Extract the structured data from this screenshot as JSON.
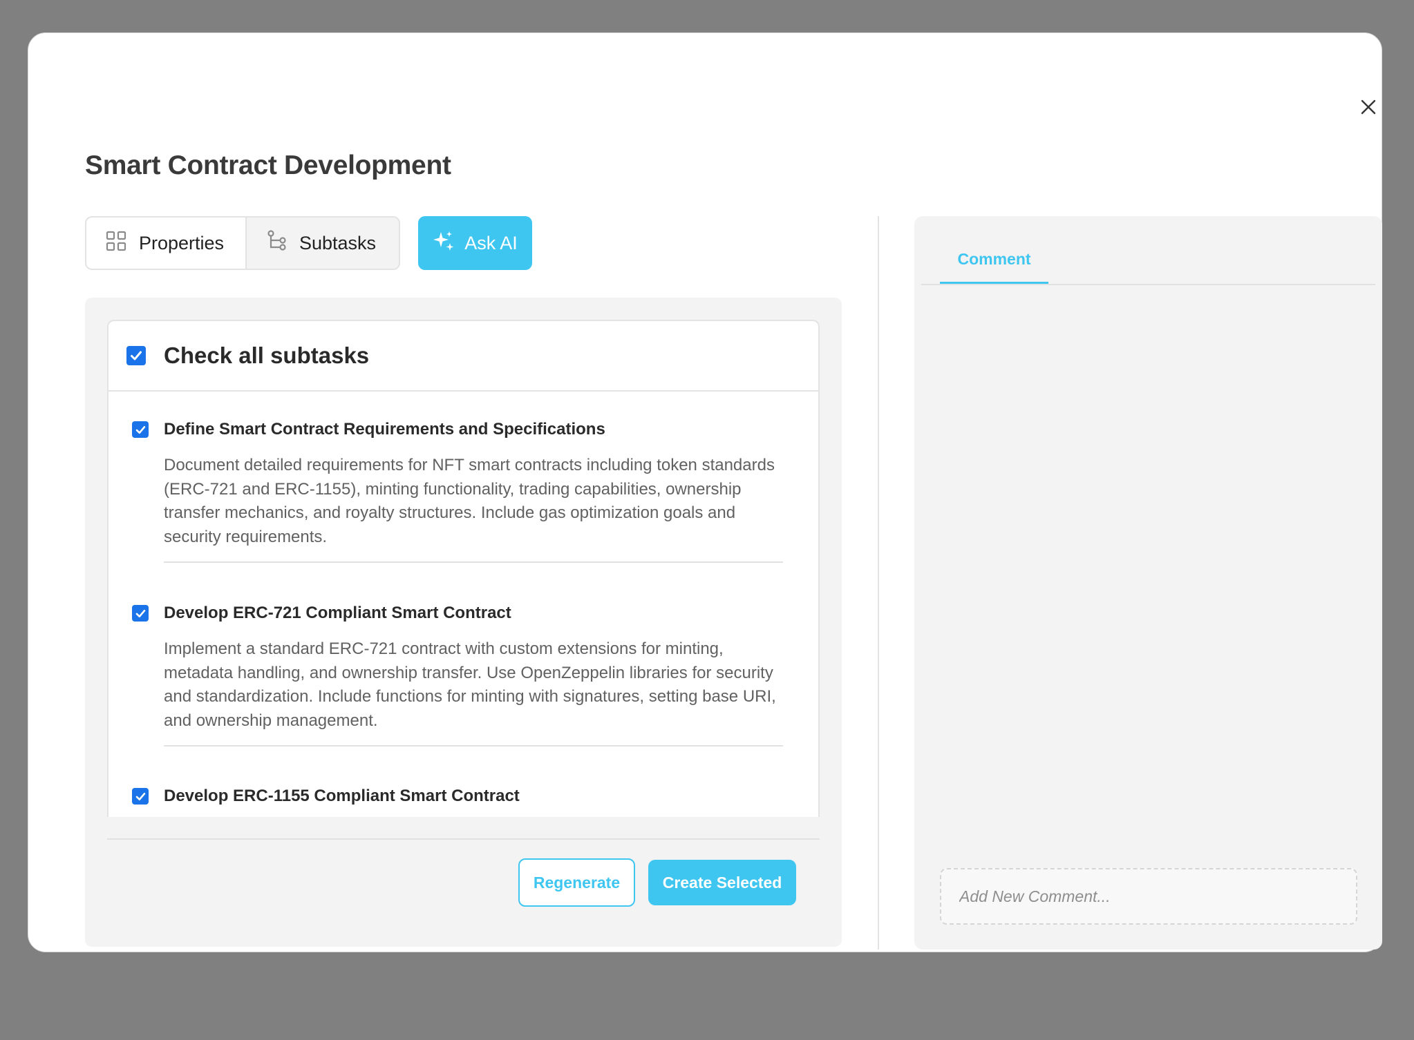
{
  "modal": {
    "title": "Smart Contract Development"
  },
  "tabs": {
    "properties_label": "Properties",
    "subtasks_label": "Subtasks",
    "ask_ai_label": "Ask AI"
  },
  "subtasks": {
    "check_all_label": "Check all subtasks",
    "check_all_checked": true,
    "items": [
      {
        "title": "Define Smart Contract Requirements and Specifications",
        "description": "Document detailed requirements for NFT smart contracts including token standards (ERC-721 and ERC-1155), minting functionality, trading capabilities, ownership transfer mechanics, and royalty structures. Include gas optimization goals and security requirements.",
        "checked": true
      },
      {
        "title": "Develop ERC-721 Compliant Smart Contract",
        "description": "Implement a standard ERC-721 contract with custom extensions for minting, metadata handling, and ownership transfer. Use OpenZeppelin libraries for security and standardization. Include functions for minting with signatures, setting base URI, and ownership management.",
        "checked": true
      },
      {
        "title": "Develop ERC-1155 Compliant Smart Contract",
        "checked": true
      }
    ],
    "regenerate_label": "Regenerate",
    "create_selected_label": "Create Selected"
  },
  "comments": {
    "tab_label": "Comment",
    "input_placeholder": "Add New Comment..."
  },
  "colors": {
    "accent": "#3ec6f1",
    "checkbox": "#1a73e8",
    "backdrop": "#808080"
  }
}
